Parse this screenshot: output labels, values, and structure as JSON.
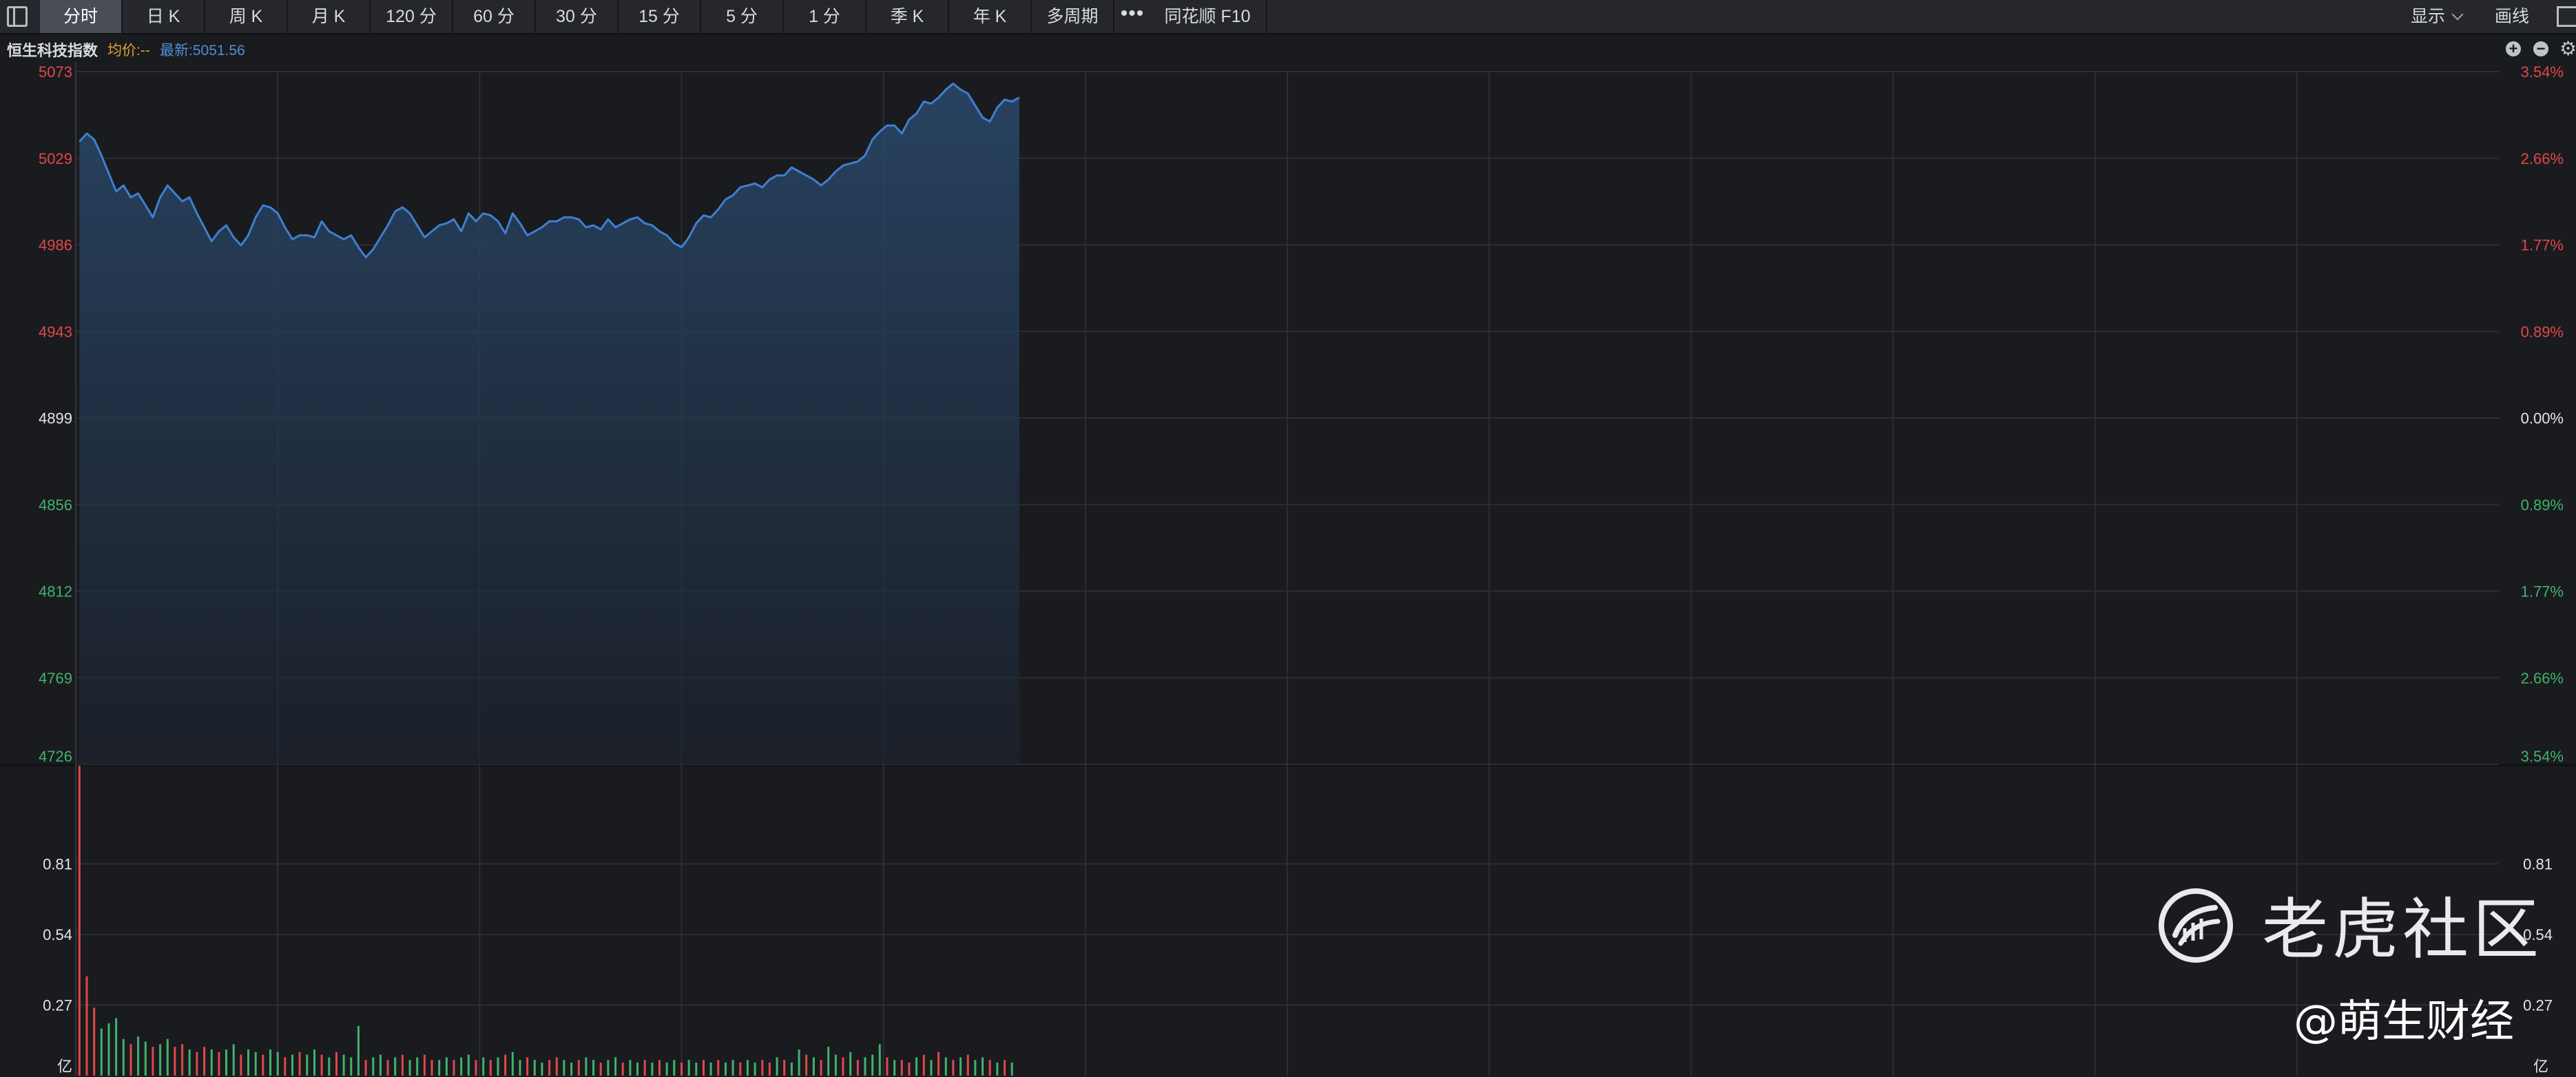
{
  "toolbar": {
    "tabs": [
      "分时",
      "日 K",
      "周 K",
      "月 K",
      "120 分",
      "60 分",
      "30 分",
      "15 分",
      "5 分",
      "1 分",
      "季 K",
      "年 K",
      "多周期"
    ],
    "active_tab": 0,
    "more": "•••",
    "f10": "同花顺 F10",
    "display": "显示",
    "draw": "画线"
  },
  "info": {
    "name": "恒生科技指数",
    "avg": "均价:--",
    "last": "最新:5051.56"
  },
  "colors": {
    "bg": "#1a1b1f",
    "up": "#e04848",
    "down": "#3fb36b",
    "neutral": "#e6e6e6",
    "line": "#3f7fd0",
    "grid": "#2c2e34"
  },
  "chart_data": {
    "type": "area",
    "y_labels_left": [
      "5073",
      "5029",
      "4986",
      "4943",
      "4899",
      "4856",
      "4812",
      "4769",
      "4726"
    ],
    "y_labels_right": [
      "3.54%",
      "2.66%",
      "1.77%",
      "0.89%",
      "0.00%",
      "0.89%",
      "1.77%",
      "2.66%",
      "3.54%"
    ],
    "ylim": [
      4726,
      5073
    ],
    "base": 4899,
    "time_slots": 330,
    "price": [
      5038,
      5042,
      5039,
      5031,
      5022,
      5013,
      5016,
      5010,
      5012,
      5006,
      5000,
      5010,
      5016,
      5012,
      5008,
      5010,
      5002,
      4995,
      4988,
      4993,
      4996,
      4990,
      4986,
      4991,
      5000,
      5006,
      5005,
      5002,
      4995,
      4989,
      4991,
      4991,
      4990,
      4998,
      4993,
      4991,
      4989,
      4991,
      4985,
      4980,
      4984,
      4990,
      4996,
      5003,
      5005,
      5002,
      4996,
      4990,
      4993,
      4996,
      4997,
      4999,
      4993,
      5002,
      4998,
      5002,
      5001,
      4998,
      4992,
      5002,
      4997,
      4991,
      4993,
      4995,
      4998,
      4998,
      5000,
      5000,
      4999,
      4995,
      4996,
      4994,
      4999,
      4995,
      4997,
      4999,
      5000,
      4997,
      4996,
      4993,
      4991,
      4987,
      4985,
      4990,
      4997,
      5001,
      5000,
      5004,
      5009,
      5011,
      5015,
      5016,
      5017,
      5015,
      5019,
      5021,
      5021,
      5025,
      5023,
      5021,
      5019,
      5016,
      5019,
      5023,
      5026,
      5027,
      5028,
      5031,
      5039,
      5043,
      5046,
      5046,
      5042,
      5049,
      5052,
      5058,
      5057,
      5060,
      5064,
      5067,
      5064,
      5062,
      5056,
      5050,
      5048,
      5055,
      5059,
      5058,
      5060
    ],
    "volume": [
      1.32,
      0.38,
      0.26,
      0.18,
      0.2,
      0.22,
      0.14,
      0.12,
      0.15,
      0.13,
      0.11,
      0.12,
      0.14,
      0.11,
      0.12,
      0.1,
      0.09,
      0.11,
      0.1,
      0.09,
      0.1,
      0.12,
      0.08,
      0.1,
      0.09,
      0.08,
      0.1,
      0.09,
      0.07,
      0.08,
      0.09,
      0.08,
      0.1,
      0.08,
      0.07,
      0.09,
      0.08,
      0.07,
      0.19,
      0.06,
      0.07,
      0.08,
      0.06,
      0.07,
      0.08,
      0.06,
      0.07,
      0.08,
      0.06,
      0.06,
      0.07,
      0.06,
      0.07,
      0.08,
      0.06,
      0.07,
      0.06,
      0.07,
      0.08,
      0.09,
      0.06,
      0.07,
      0.06,
      0.05,
      0.06,
      0.07,
      0.06,
      0.05,
      0.06,
      0.07,
      0.06,
      0.05,
      0.06,
      0.07,
      0.05,
      0.06,
      0.05,
      0.06,
      0.05,
      0.06,
      0.05,
      0.06,
      0.05,
      0.06,
      0.05,
      0.06,
      0.05,
      0.06,
      0.05,
      0.06,
      0.05,
      0.06,
      0.05,
      0.06,
      0.05,
      0.07,
      0.06,
      0.05,
      0.1,
      0.08,
      0.07,
      0.06,
      0.11,
      0.08,
      0.07,
      0.09,
      0.06,
      0.07,
      0.08,
      0.12,
      0.07,
      0.06,
      0.06,
      0.05,
      0.07,
      0.08,
      0.06,
      0.09,
      0.07,
      0.06,
      0.07,
      0.08,
      0.06,
      0.07,
      0.06,
      0.05,
      0.06,
      0.05
    ],
    "volume_up": [
      1,
      1,
      1,
      0,
      0,
      0,
      0,
      1,
      0,
      0,
      1,
      0,
      0,
      1,
      1,
      0,
      1,
      1,
      0,
      1,
      0,
      0,
      1,
      0,
      0,
      1,
      0,
      0,
      1,
      0,
      1,
      0,
      0,
      1,
      0,
      1,
      0,
      0,
      0,
      1,
      0,
      0,
      1,
      0,
      1,
      0,
      0,
      1,
      1,
      0,
      0,
      1,
      0,
      0,
      1,
      0,
      1,
      0,
      1,
      0,
      0,
      1,
      0,
      0,
      1,
      1,
      0,
      0,
      1,
      0,
      0,
      1,
      0,
      0,
      1,
      0,
      0,
      1,
      0,
      1,
      0,
      0,
      1,
      0,
      0,
      1,
      0,
      1,
      0,
      0,
      1,
      0,
      0,
      1,
      1,
      0,
      1,
      0,
      0,
      1,
      0,
      1,
      0,
      0,
      1,
      0,
      1,
      0,
      0,
      0,
      1,
      0,
      1,
      1,
      0,
      1,
      0,
      1,
      0,
      1,
      0,
      1,
      0,
      0,
      1,
      0,
      1,
      0,
      1
    ],
    "vol_labels": [
      "0.81",
      "0.54",
      "0.27"
    ],
    "vol_unit": "亿",
    "vol_max": 1.08
  },
  "watermark": {
    "site": "老虎社区",
    "author": "@萌生财经"
  }
}
